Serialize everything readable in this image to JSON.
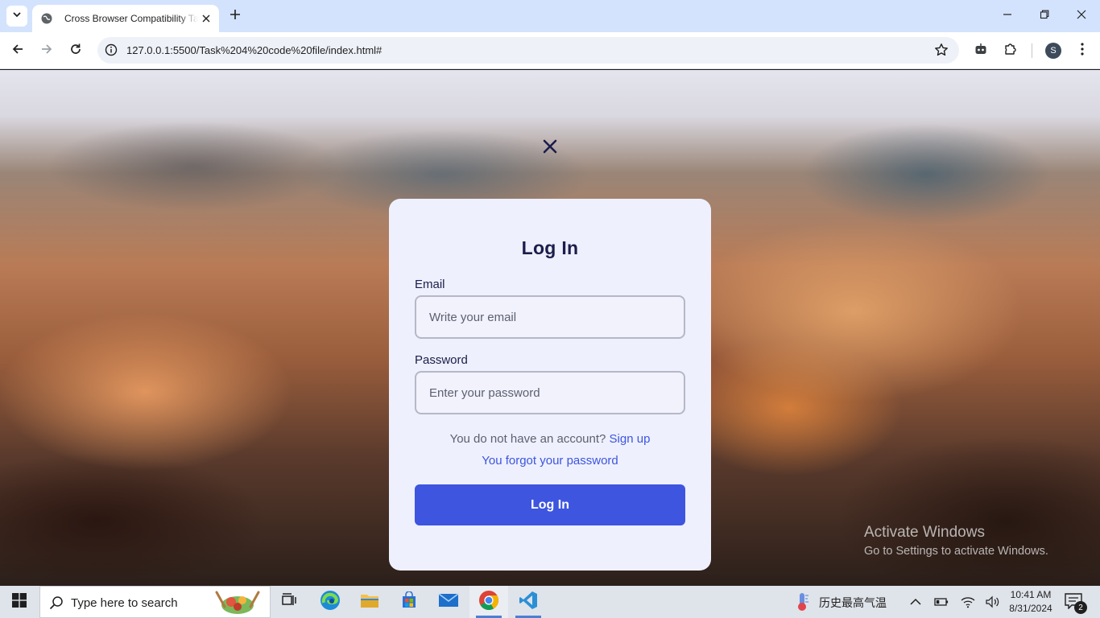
{
  "browser": {
    "tab_title": "Cross Browser Compatibility Task",
    "url": "127.0.0.1:5500/Task%204%20code%20file/index.html#",
    "profile_initial": "S"
  },
  "page": {
    "login": {
      "title": "Log In",
      "email_label": "Email",
      "email_placeholder": "Write your email",
      "password_label": "Password",
      "password_placeholder": "Enter your password",
      "no_account_text": "You do not have an account?",
      "signup_link": "Sign up",
      "forgot_link": "You forgot your password",
      "submit_label": "Log In"
    },
    "watermark": {
      "title": "Activate Windows",
      "subtitle": "Go to Settings to activate Windows."
    }
  },
  "taskbar": {
    "search_placeholder": "Type here to search",
    "weather_text": "历史最高气温",
    "time": "10:41 AM",
    "date": "8/31/2024",
    "notification_count": "2"
  },
  "colors": {
    "accent": "#3d55df",
    "card_bg": "#eef0fd",
    "title_text": "#1b1d4b",
    "tabstrip": "#d3e3fd"
  }
}
